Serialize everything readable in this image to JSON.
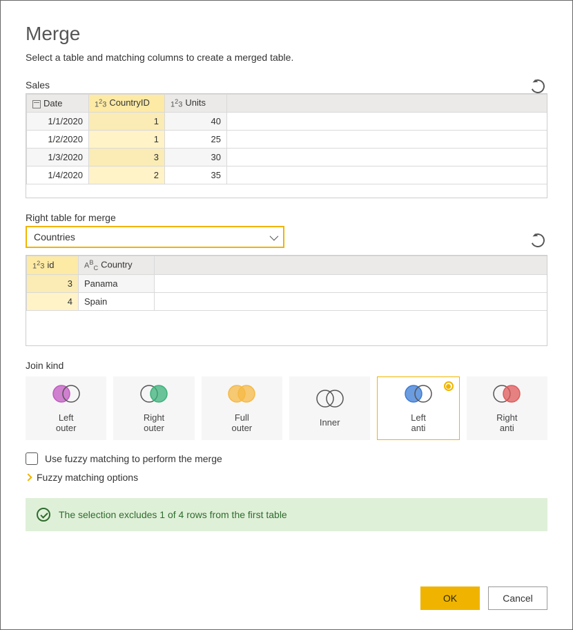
{
  "title": "Merge",
  "subtitle": "Select a table and matching columns to create a merged table.",
  "top_table": {
    "name": "Sales",
    "columns": [
      {
        "label": "Date",
        "type": "date",
        "selected": false
      },
      {
        "label": "CountryID",
        "type": "number",
        "selected": true
      },
      {
        "label": "Units",
        "type": "number",
        "selected": false
      }
    ],
    "rows": [
      [
        "1/1/2020",
        "1",
        "40"
      ],
      [
        "1/2/2020",
        "1",
        "25"
      ],
      [
        "1/3/2020",
        "3",
        "30"
      ],
      [
        "1/4/2020",
        "2",
        "35"
      ]
    ]
  },
  "right_section_label": "Right table for merge",
  "right_table_dropdown": "Countries",
  "right_table": {
    "columns": [
      {
        "label": "id",
        "type": "number",
        "selected": true
      },
      {
        "label": "Country",
        "type": "text",
        "selected": false
      }
    ],
    "rows": [
      [
        "3",
        "Panama"
      ],
      [
        "4",
        "Spain"
      ]
    ]
  },
  "join_label": "Join kind",
  "join_kinds": [
    {
      "label": "Left outer",
      "left_color": "#c25ac2",
      "right_color": "transparent",
      "overlap_color": "#c25ac2"
    },
    {
      "label": "Right outer",
      "left_color": "transparent",
      "right_color": "#3bb27a",
      "overlap_color": "#3bb27a"
    },
    {
      "label": "Full outer",
      "left_color": "#f5b946",
      "right_color": "#f5b946",
      "overlap_color": "#f5b946"
    },
    {
      "label": "Inner",
      "left_color": "transparent",
      "right_color": "transparent",
      "overlap_color": "#777"
    },
    {
      "label": "Left anti",
      "left_color": "#3a7bd5",
      "right_color": "transparent",
      "overlap_color": "transparent"
    },
    {
      "label": "Right anti",
      "left_color": "transparent",
      "right_color": "#e05a5a",
      "overlap_color": "transparent"
    }
  ],
  "join_selected_index": 4,
  "fuzzy_checkbox_label": "Use fuzzy matching to perform the merge",
  "fuzzy_options_label": "Fuzzy matching options",
  "status_message": "The selection excludes 1 of 4 rows from the first table",
  "buttons": {
    "ok": "OK",
    "cancel": "Cancel"
  }
}
